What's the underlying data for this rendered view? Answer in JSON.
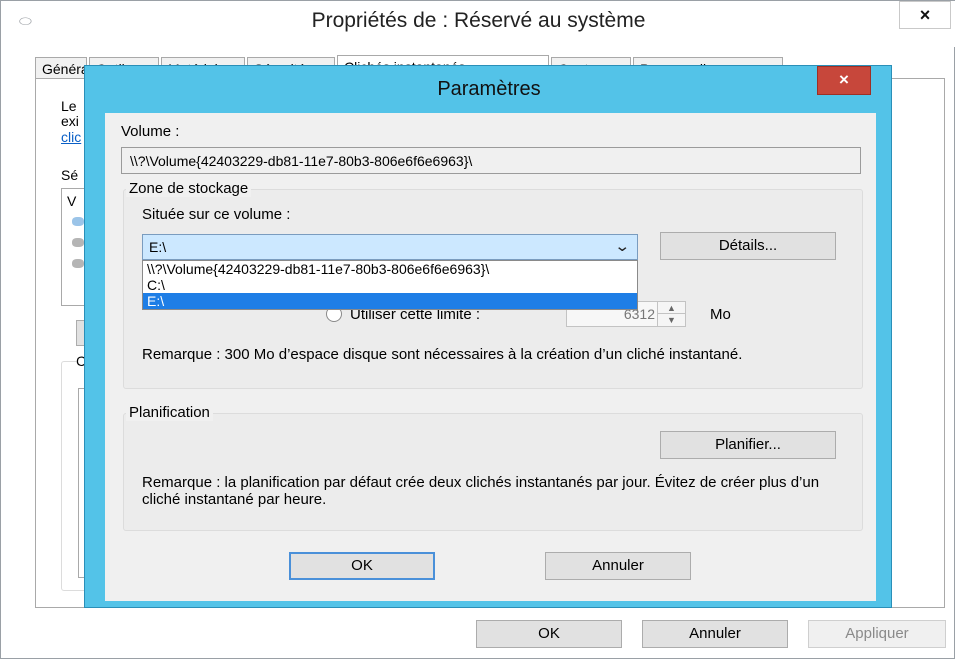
{
  "outer": {
    "title": "Propriétés de : Réservé au système",
    "close_glyph": "×",
    "tabs": [
      "Général",
      "Outils",
      "Matériel",
      "Sécurité",
      "Clichés instantanés",
      "Quota",
      "Personnaliser"
    ],
    "active_tab": "Clichés instantanés",
    "peek_texts": [
      "Le",
      "exi",
      "clic",
      "Sé",
      "V",
      "C"
    ],
    "footer": {
      "ok": "OK",
      "cancel": "Annuler",
      "apply": "Appliquer"
    }
  },
  "dialog": {
    "title": "Paramètres",
    "close_glyph": "×",
    "volume_label": "Volume :",
    "volume_value": "\\\\?\\Volume{42403229-db81-11e7-80b3-806e6f6e6963}\\",
    "storage": {
      "group_title": "Zone de stockage",
      "located_label": "Située sur ce volume :",
      "selected": "E:\\",
      "options": [
        "\\\\?\\Volume{42403229-db81-11e7-80b3-806e6f6e6963}\\",
        "C:\\",
        "E:\\"
      ],
      "details_button": "Détails...",
      "limit_label": "Utiliser cette limite :",
      "limit_value": "6312",
      "limit_unit": "Mo",
      "note": "Remarque : 300 Mo d’espace disque sont nécessaires à la création d’un cliché instantané."
    },
    "schedule": {
      "group_title": "Planification",
      "button": "Planifier...",
      "note": "Remarque : la planification par défaut crée deux clichés instantanés par jour. Évitez de créer plus d’un cliché instantané par heure."
    },
    "buttons": {
      "ok": "OK",
      "cancel": "Annuler"
    }
  }
}
